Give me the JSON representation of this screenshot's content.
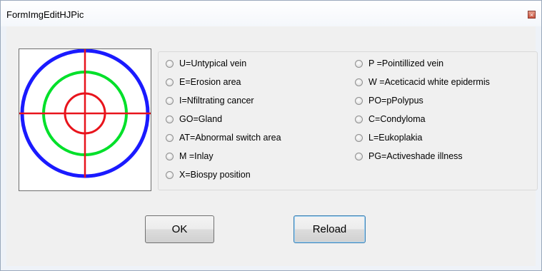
{
  "window": {
    "title": "FormImgEditHJPic",
    "close_glyph": "×"
  },
  "picture": {
    "description_icon": "crosshair-target-icon",
    "colors": {
      "outer_ring": "#1a1aff",
      "middle_ring": "#00e02a",
      "inner_ring": "#e8141c",
      "crosshair": "#e8141c"
    }
  },
  "options": {
    "left": [
      "U=Untypical vein",
      "E=Erosion area",
      "I=Nfiltrating cancer",
      "GO=Gland",
      "AT=Abnormal switch area",
      "M =Inlay",
      "X=Biospy position"
    ],
    "right": [
      "P =Pointillized vein",
      "W =Aceticacid white epidermis",
      "PO=pPolypus",
      "C=Condyloma",
      "L=Eukoplakia",
      "PG=Activeshade illness"
    ]
  },
  "buttons": {
    "ok_label": "OK",
    "reload_label": "Reload"
  }
}
